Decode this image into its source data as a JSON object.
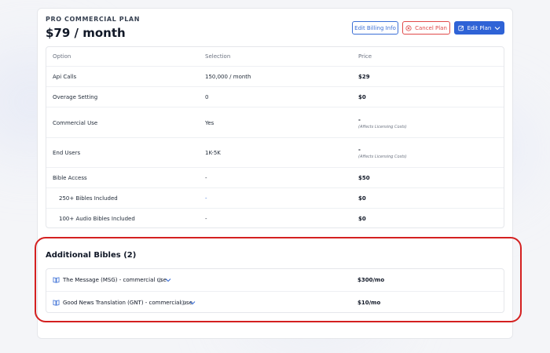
{
  "plan": {
    "label": "PRO COMMERCIAL PLAN",
    "price": "$79 / month"
  },
  "actions": {
    "edit_billing": "Edit Billing Info",
    "cancel_plan": "Cancel Plan",
    "edit_plan": "Edit Plan"
  },
  "table": {
    "headers": [
      "Option",
      "Selection",
      "Price"
    ],
    "rows": [
      {
        "option": "Api Calls",
        "selection": "150,000 / month",
        "price": "$29",
        "note": ""
      },
      {
        "option": "Overage Setting",
        "selection": "0",
        "price": "$0",
        "note": ""
      },
      {
        "option": "Commercial Use",
        "selection": "Yes",
        "price": "-",
        "note": "(Affects Licensing Costs)"
      },
      {
        "option": "End Users",
        "selection": "1K-5K",
        "price": "-",
        "note": "(Affects Licensing Costs)"
      },
      {
        "option": "Bible Access",
        "selection": "-",
        "price": "$50",
        "note": ""
      },
      {
        "option": "250+ Bibles Included",
        "selection": "-",
        "price": "$0",
        "note": ""
      },
      {
        "option": "100+ Audio Bibles Included",
        "selection": "-",
        "price": "$0",
        "note": ""
      }
    ]
  },
  "additional": {
    "title": "Additional Bibles (2)",
    "items": [
      {
        "name": "The Message (MSG) - commercial use",
        "price": "$300/mo"
      },
      {
        "name": "Good News Translation (GNT) - commercial use",
        "price": "$10/mo"
      }
    ]
  },
  "colors": {
    "accent": "#2f63d6",
    "danger": "#e04a4a",
    "highlight": "#d42020"
  }
}
